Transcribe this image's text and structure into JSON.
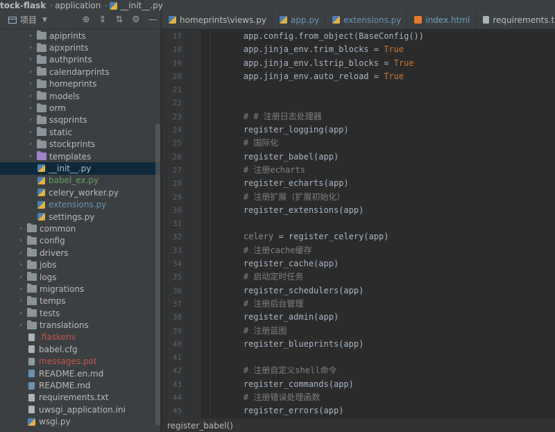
{
  "breadcrumb": {
    "items": [
      "tock-flask",
      "application",
      "__init__.py"
    ]
  },
  "project_panel": {
    "title": "项目",
    "tools": [
      "⊕",
      "⇕",
      "⇅",
      "⚙",
      "—"
    ],
    "tree": [
      {
        "label": "apiprints",
        "type": "folder",
        "depth": 1,
        "arrow": "›"
      },
      {
        "label": "apxprints",
        "type": "folder",
        "depth": 1,
        "arrow": "›"
      },
      {
        "label": "authprints",
        "type": "folder",
        "depth": 1,
        "arrow": "›"
      },
      {
        "label": "calendarprints",
        "type": "folder",
        "depth": 1,
        "arrow": "›"
      },
      {
        "label": "homeprints",
        "type": "folder",
        "depth": 1,
        "arrow": "›"
      },
      {
        "label": "models",
        "type": "folder",
        "depth": 1,
        "arrow": "›"
      },
      {
        "label": "orm",
        "type": "folder",
        "depth": 1,
        "arrow": "›"
      },
      {
        "label": "ssqprints",
        "type": "folder",
        "depth": 1,
        "arrow": "›"
      },
      {
        "label": "static",
        "type": "folder",
        "depth": 1,
        "arrow": "›"
      },
      {
        "label": "stockprints",
        "type": "folder",
        "depth": 1,
        "arrow": "›"
      },
      {
        "label": "templates",
        "type": "folder-purple",
        "depth": 1,
        "arrow": "›"
      },
      {
        "label": "__init__.py",
        "type": "py",
        "depth": 1,
        "arrow": "",
        "selected": true
      },
      {
        "label": "babel_ex.py",
        "type": "py",
        "depth": 1,
        "arrow": "",
        "color": "green"
      },
      {
        "label": "celery_worker.py",
        "type": "py",
        "depth": 1,
        "arrow": ""
      },
      {
        "label": "extensions.py",
        "type": "py",
        "depth": 1,
        "arrow": "",
        "color": "blue"
      },
      {
        "label": "settings.py",
        "type": "py",
        "depth": 1,
        "arrow": ""
      },
      {
        "label": "common",
        "type": "folder",
        "depth": 0,
        "arrow": "›"
      },
      {
        "label": "config",
        "type": "folder",
        "depth": 0,
        "arrow": "›"
      },
      {
        "label": "drivers",
        "type": "folder",
        "depth": 0,
        "arrow": "›"
      },
      {
        "label": "jobs",
        "type": "folder",
        "depth": 0,
        "arrow": "›"
      },
      {
        "label": "logs",
        "type": "folder",
        "depth": 0,
        "arrow": "›"
      },
      {
        "label": "migrations",
        "type": "folder",
        "depth": 0,
        "arrow": "›"
      },
      {
        "label": "temps",
        "type": "folder",
        "depth": 0,
        "arrow": "›"
      },
      {
        "label": "tests",
        "type": "folder",
        "depth": 0,
        "arrow": "›"
      },
      {
        "label": "translations",
        "type": "folder",
        "depth": 0,
        "arrow": "›"
      },
      {
        "label": ".flaskenv",
        "type": "file",
        "depth": 0,
        "arrow": "",
        "color": "red"
      },
      {
        "label": "babel.cfg",
        "type": "file",
        "depth": 0,
        "arrow": ""
      },
      {
        "label": "messages.pot",
        "type": "pot",
        "depth": 0,
        "arrow": "",
        "color": "red"
      },
      {
        "label": "README.en.md",
        "type": "md",
        "depth": 0,
        "arrow": ""
      },
      {
        "label": "README.md",
        "type": "md",
        "depth": 0,
        "arrow": ""
      },
      {
        "label": "requirements.txt",
        "type": "file",
        "depth": 0,
        "arrow": ""
      },
      {
        "label": "uwsgi_application.ini",
        "type": "ini",
        "depth": 0,
        "arrow": ""
      },
      {
        "label": "wsgi.py",
        "type": "py",
        "depth": 0,
        "arrow": ""
      }
    ]
  },
  "tabs": [
    {
      "label": "homeprints\\views.py",
      "icon": "py",
      "color": "plain"
    },
    {
      "label": "app.py",
      "icon": "py",
      "color": "blue"
    },
    {
      "label": "extensions.py",
      "icon": "py",
      "color": "blue"
    },
    {
      "label": "index.html",
      "icon": "html",
      "color": "teal"
    },
    {
      "label": "requirements.txt",
      "icon": "txt",
      "color": "plain"
    }
  ],
  "code": {
    "lines": [
      {
        "n": "17",
        "parts": [
          [
            "",
            "    app.config.from_object(BaseConfig())"
          ]
        ]
      },
      {
        "n": "18",
        "parts": [
          [
            "",
            "    app.jinja_env.trim_blocks = "
          ],
          [
            "kw",
            "True"
          ]
        ]
      },
      {
        "n": "19",
        "parts": [
          [
            "",
            "    app.jinja_env.lstrip_blocks = "
          ],
          [
            "kw",
            "True"
          ]
        ]
      },
      {
        "n": "20",
        "parts": [
          [
            "",
            "    app.jinja_env.auto_reload = "
          ],
          [
            "kw",
            "True"
          ]
        ]
      },
      {
        "n": "21",
        "parts": [
          [
            "",
            ""
          ]
        ]
      },
      {
        "n": "22",
        "parts": [
          [
            "",
            ""
          ]
        ]
      },
      {
        "n": "23",
        "parts": [
          [
            "cm",
            "    # # 注册日志处理器"
          ]
        ]
      },
      {
        "n": "24",
        "parts": [
          [
            "",
            "    register_logging(app)"
          ]
        ]
      },
      {
        "n": "25",
        "parts": [
          [
            "cm",
            "    # 国际化"
          ]
        ]
      },
      {
        "n": "26",
        "parts": [
          [
            "",
            "    register_babel(app)"
          ]
        ]
      },
      {
        "n": "27",
        "parts": [
          [
            "cm",
            "    # 注册echarts"
          ]
        ]
      },
      {
        "n": "28",
        "parts": [
          [
            "",
            "    register_echarts(app)"
          ]
        ]
      },
      {
        "n": "29",
        "parts": [
          [
            "cm",
            "    # 注册扩展（扩展初始化）"
          ]
        ]
      },
      {
        "n": "30",
        "parts": [
          [
            "",
            "    register_extensions(app)"
          ]
        ]
      },
      {
        "n": "31",
        "parts": [
          [
            "",
            ""
          ]
        ]
      },
      {
        "n": "32",
        "parts": [
          [
            "dim",
            "    celery"
          ],
          [
            "",
            " = register_celery(app)"
          ]
        ]
      },
      {
        "n": "33",
        "parts": [
          [
            "cm",
            "    # 注册cache缓存"
          ]
        ]
      },
      {
        "n": "34",
        "parts": [
          [
            "",
            "    register_cache(app)"
          ]
        ]
      },
      {
        "n": "35",
        "parts": [
          [
            "cm",
            "    # 启动定时任务"
          ]
        ]
      },
      {
        "n": "36",
        "parts": [
          [
            "",
            "    register_schedulers(app)"
          ]
        ]
      },
      {
        "n": "37",
        "parts": [
          [
            "cm",
            "    # 注册后台管理"
          ]
        ]
      },
      {
        "n": "38",
        "parts": [
          [
            "",
            "    register_admin(app)"
          ]
        ]
      },
      {
        "n": "39",
        "parts": [
          [
            "cm",
            "    # 注册蓝图"
          ]
        ]
      },
      {
        "n": "40",
        "parts": [
          [
            "",
            "    register_blueprints(app)"
          ]
        ]
      },
      {
        "n": "41",
        "parts": [
          [
            "",
            ""
          ]
        ]
      },
      {
        "n": "42",
        "parts": [
          [
            "cm",
            "    # 注册自定义shell命令"
          ]
        ]
      },
      {
        "n": "43",
        "parts": [
          [
            "",
            "    register_commands(app)"
          ]
        ]
      },
      {
        "n": "44",
        "parts": [
          [
            "cm",
            "    # 注册错误处理函数"
          ]
        ]
      },
      {
        "n": "45",
        "parts": [
          [
            "",
            "    register_errors(app)"
          ]
        ]
      }
    ]
  },
  "footer": {
    "breadcrumb": "register_babel()"
  }
}
